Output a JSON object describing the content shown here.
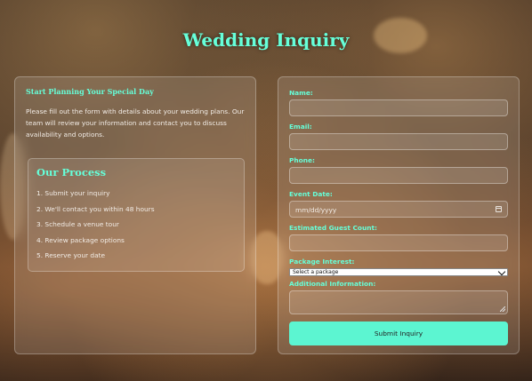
{
  "page": {
    "title": "Wedding Inquiry"
  },
  "info": {
    "heading": "Start Planning Your Special Day",
    "intro": "Please fill out the form with details about your wedding plans. Our team will review your information and contact you to discuss availability and options.",
    "process": {
      "heading": "Our Process",
      "steps": [
        "1. Submit your inquiry",
        "2. We'll contact you within 48 hours",
        "3. Schedule a venue tour",
        "4. Review package options",
        "5. Reserve your date"
      ]
    }
  },
  "form": {
    "name_label": "Name:",
    "email_label": "Email:",
    "phone_label": "Phone:",
    "event_date_label": "Event Date:",
    "event_date_placeholder": "mm/dd/yyyy",
    "guest_count_label": "Estimated Guest Count:",
    "package_label": "Package Interest:",
    "package_selected": "Select a package",
    "additional_label": "Additional Information:",
    "submit_label": "Submit Inquiry"
  },
  "colors": {
    "accent": "#66ffd9",
    "button": "#5cf5d1"
  },
  "icons": {
    "date": "calendar-icon",
    "select": "chevron-down-icon",
    "textarea": "resize-handle-icon"
  }
}
